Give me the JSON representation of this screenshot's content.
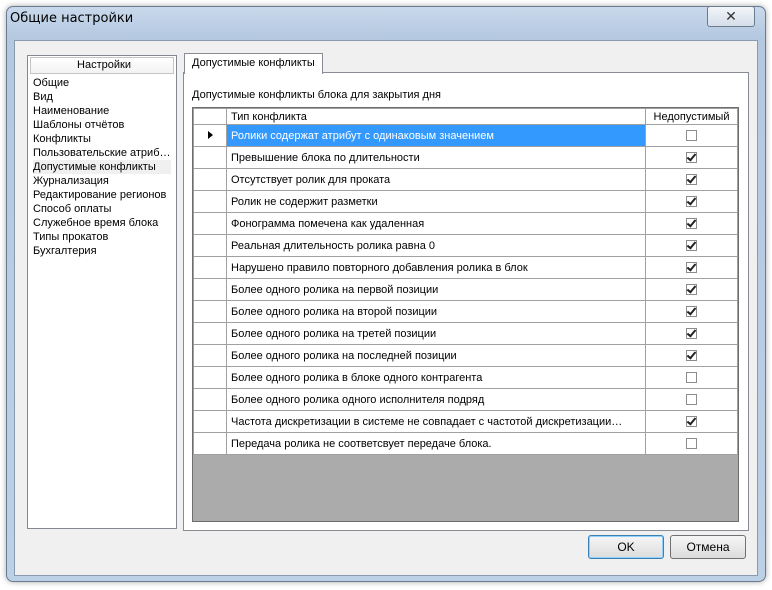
{
  "window": {
    "title": "Общие настройки",
    "close_symbol": "✕"
  },
  "nav": {
    "header": "Настройки",
    "items": [
      "Общие",
      "Вид",
      "Наименование",
      "Шаблоны отчётов",
      "Конфликты",
      "Пользовательские атриб…",
      "Допустимые конфликты",
      "Журнализация",
      "Редактирование регионов",
      "Способ оплаты",
      "Служебное время блока",
      "Типы прокатов",
      "Бухгалтерия"
    ],
    "selected_index": 6
  },
  "tab": {
    "label": "Допустимые конфликты"
  },
  "panel": {
    "caption": "Допустимые конфликты блока для закрытия дня"
  },
  "grid": {
    "columns": [
      "Тип конфликта",
      "Недопустимый"
    ],
    "selected_row": 0,
    "rows": [
      {
        "type": "Ролики содержат атрибут с одинаковым значением",
        "disallowed": false
      },
      {
        "type": "Превышение блока по длительности",
        "disallowed": true
      },
      {
        "type": "Отсутствует ролик для проката",
        "disallowed": true
      },
      {
        "type": "Ролик не содержит разметки",
        "disallowed": true
      },
      {
        "type": "Фонограмма помечена как удаленная",
        "disallowed": true
      },
      {
        "type": "Реальная длительность ролика равна 0",
        "disallowed": true
      },
      {
        "type": "Нарушено правило повторного добавления ролика в блок",
        "disallowed": true
      },
      {
        "type": "Более одного ролика на первой позиции",
        "disallowed": true
      },
      {
        "type": "Более одного ролика на второй позиции",
        "disallowed": true
      },
      {
        "type": "Более одного ролика на третей позиции",
        "disallowed": true
      },
      {
        "type": "Более одного ролика на последней позиции",
        "disallowed": true
      },
      {
        "type": "Более одного ролика в блоке одного контрагента",
        "disallowed": false
      },
      {
        "type": "Более одного ролика одного исполнителя подряд",
        "disallowed": false
      },
      {
        "type": "Частота дискретизации в системе не совпадает с частотой дискретизации…",
        "disallowed": true
      },
      {
        "type": "Передача ролика не соответсвует передаче блока.",
        "disallowed": false
      }
    ]
  },
  "buttons": {
    "ok": "OK",
    "cancel": "Отмена"
  }
}
